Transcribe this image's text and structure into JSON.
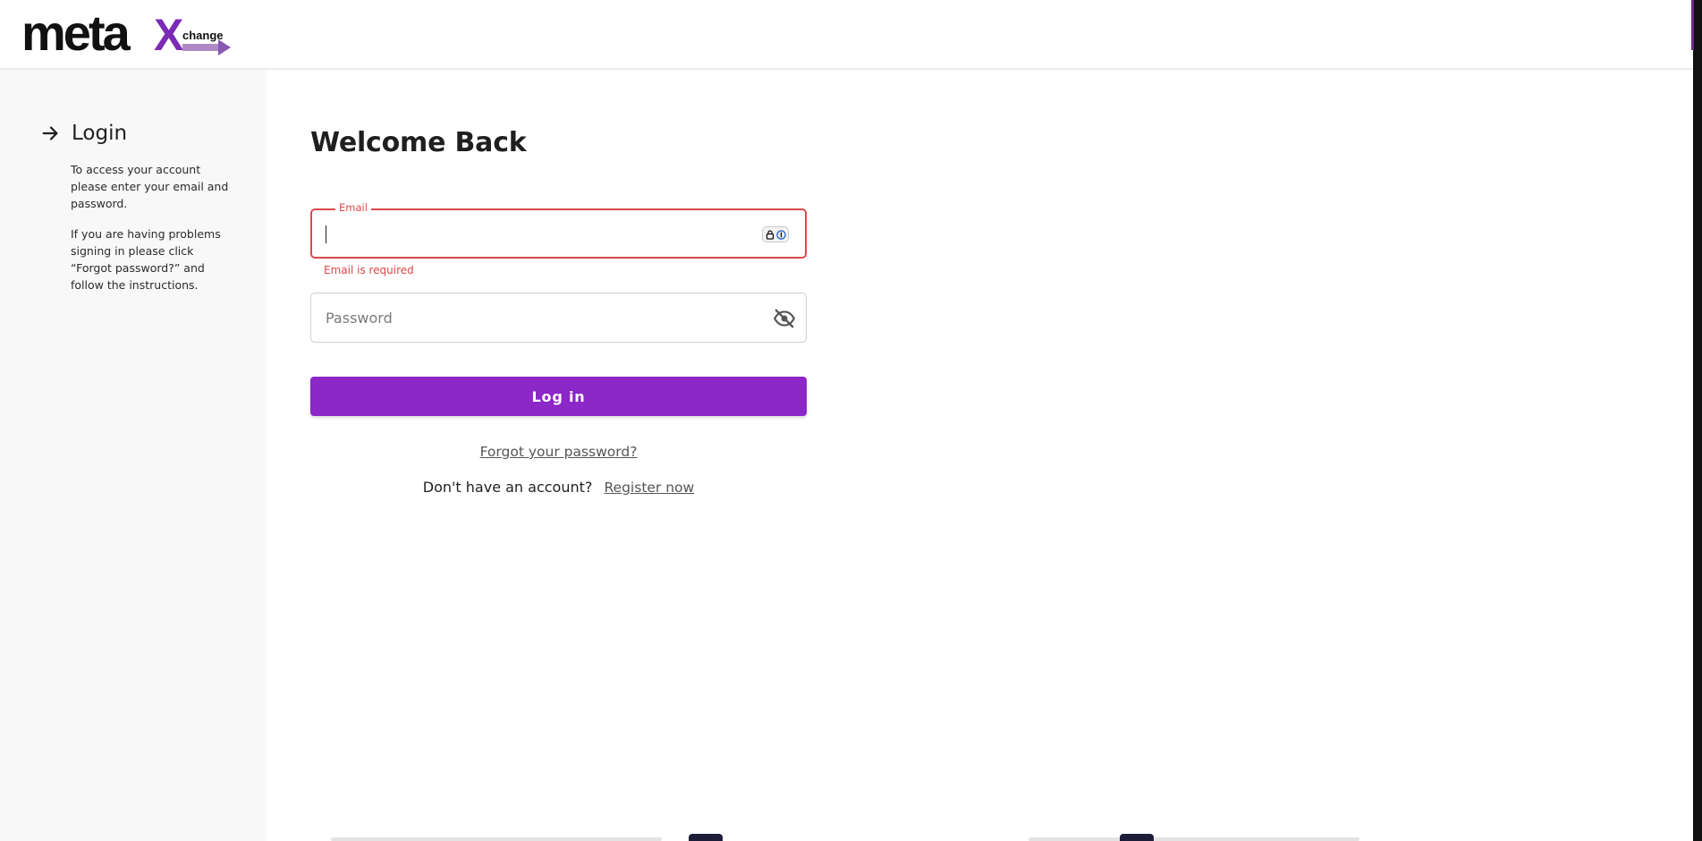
{
  "brand": {
    "logo_main": "meta",
    "logo_x": "X",
    "logo_small": "change",
    "accent_color": "#8c27c8",
    "logo_dark": "#111111"
  },
  "sidebar": {
    "title": "Login",
    "title_icon": "arrow-right-icon",
    "paragraph1": "To access your account please enter your email and password.",
    "paragraph2": "If you are having problems signing in please click “Forgot password?” and follow the instructions."
  },
  "main": {
    "heading": "Welcome Back",
    "email": {
      "label": "Email",
      "value": "",
      "error": "Email is required",
      "icon": "password-manager-icon",
      "error_color": "#d94a4a"
    },
    "password": {
      "placeholder": "Password",
      "value": "",
      "icon": "eye-off-icon"
    },
    "login_button": "Log in",
    "forgot_link": "Forgot your password?",
    "register_prompt": "Don't have an account?",
    "register_link": "Register now"
  }
}
